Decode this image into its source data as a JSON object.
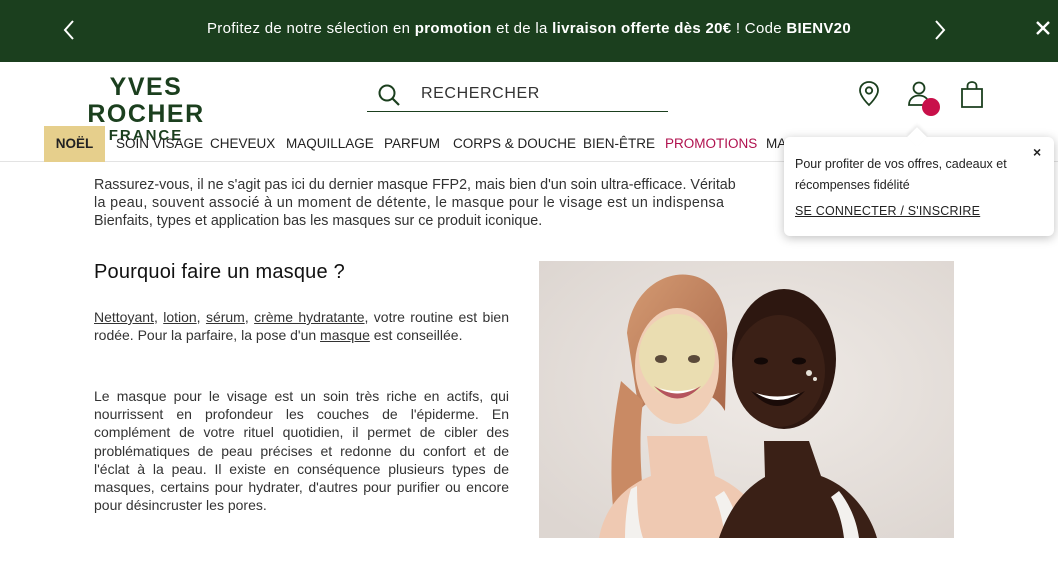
{
  "promo_banner": {
    "parts": [
      {
        "text": "Profitez de notre sélection en ",
        "bold": false
      },
      {
        "text": "promotion",
        "bold": true
      },
      {
        "text": " et de la ",
        "bold": false
      },
      {
        "text": "livraison offerte dès 20€",
        "bold": true
      },
      {
        "text": " ! Code ",
        "bold": false
      },
      {
        "text": "BIENV20",
        "bold": true
      }
    ],
    "prev_icon": "chevron-left-icon",
    "next_icon": "chevron-right-icon",
    "close_icon": "close-icon",
    "background": "#1b3f1e"
  },
  "header": {
    "logo_line1": "YVES ROCHER",
    "logo_line2": "FRANCE",
    "search_placeholder": "RECHERCHER",
    "icons": [
      "search-icon",
      "location-pin-icon",
      "user-icon",
      "shopping-bag-icon"
    ],
    "notification_color": "#c8104a"
  },
  "nav": {
    "items": [
      {
        "label": "NOËL"
      },
      {
        "label": "SOIN VISAGE"
      },
      {
        "label": "CHEVEUX"
      },
      {
        "label": "MAQUILLAGE"
      },
      {
        "label": "PARFUM"
      },
      {
        "label": "CORPS & DOUCHE"
      },
      {
        "label": "BIEN-ÊTRE"
      },
      {
        "label": "PROMOTIONS"
      },
      {
        "label": "MA"
      }
    ],
    "highlight_color": "#e6cf8c",
    "promo_color": "#b0114e"
  },
  "article": {
    "intro_lines": [
      "Rassurez-vous, il ne s'agit pas ici du dernier masque FFP2, mais bien d'un soin ultra-efficace. Véritab",
      "la peau, souvent associé à un moment de détente, le masque pour le visage est un indispensa",
      "Bienfaits, types et application bas les masques sur ce produit iconique."
    ],
    "heading": "Pourquoi faire un masque ?",
    "para1": {
      "links": [
        "Nettoyant",
        "lotion",
        "sérum",
        "crème hydratante"
      ],
      "separators": [
        ", ",
        ", ",
        ", "
      ],
      "middle": ", votre routine est bien rodée. Pour la parfaire, la pose d'un ",
      "link_masque": "masque",
      "end": " est conseillée."
    },
    "para2": "Le masque pour le visage est un soin très riche en actifs, qui nourrissent en profondeur les couches de l'épiderme. En complément de votre rituel quotidien, il permet de cibler des problématiques de peau précises et redonne du confort et de l'éclat à la peau. Il existe en conséquence plusieurs types de masques, certains pour hydrater, d'autres pour purifier ou encore pour désincruster les pores."
  },
  "popup": {
    "text": "Pour profiter de vos offres, cadeaux et récompenses fidélité",
    "link": "SE CONNECTER / S'INSCRIRE",
    "close_label": "×"
  }
}
